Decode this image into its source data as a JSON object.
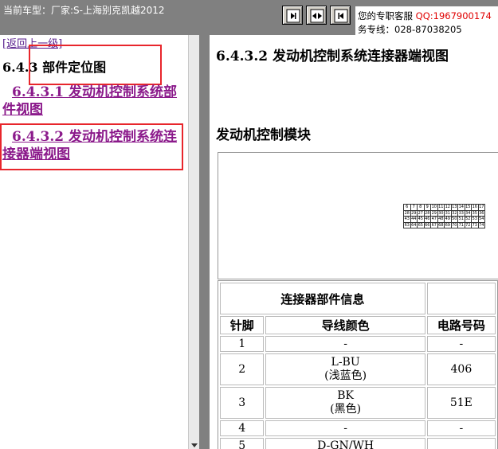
{
  "header": {
    "vehicle_text": "当前车型：厂家:S-上海别克凯越2012",
    "service_prefix": "您的专职客服",
    "qq_text": "QQ:1967900174",
    "hotline": "务专线：028-87038205"
  },
  "nav_buttons": [
    {
      "name": "first-page-icon"
    },
    {
      "name": "toggle-panes-icon"
    },
    {
      "name": "previous-page-icon"
    }
  ],
  "left_panel": {
    "back_link": "[返回上一级]",
    "section_title": "6.4.3 部件定位图",
    "toc": [
      {
        "label": "6.4.3.1 发动机控制系统部件视图"
      },
      {
        "label": "6.4.3.2 发动机控制系统连接器端视图"
      }
    ]
  },
  "content": {
    "title": "6.4.3.2 发动机控制系统连接器端视图",
    "subsection": "发动机控制模块",
    "connector_info_header": "连接器部件信息",
    "columns": [
      "针脚",
      "导线颜色",
      "电路号码"
    ],
    "rows": [
      {
        "pin": "1",
        "color": "-",
        "circuit": "-"
      },
      {
        "pin": "2",
        "color": "L-BU\n(浅蓝色)",
        "circuit": "406"
      },
      {
        "pin": "3",
        "color": "BK\n(黑色)",
        "circuit": "51E"
      },
      {
        "pin": "4",
        "color": "-",
        "circuit": "-"
      },
      {
        "pin": "5",
        "color": "D-GN/WH",
        "circuit": ""
      }
    ],
    "connector_grid": [
      [
        "6",
        "7",
        "8",
        "9",
        "10",
        "11",
        "12",
        "13",
        "14",
        "15",
        "16",
        "17"
      ],
      [
        "28",
        "29",
        "27",
        "28",
        "29",
        "30",
        "31",
        "32",
        "33",
        "34",
        "35",
        "36"
      ],
      [
        "43",
        "44",
        "45",
        "46",
        "47",
        "48",
        "49",
        "50",
        "51",
        "52",
        "53",
        "54"
      ],
      [
        "63",
        "64",
        "65",
        "66",
        "67",
        "68",
        "69",
        "70",
        "71",
        "72",
        "73",
        "74"
      ]
    ]
  },
  "colors": {
    "header_bg": "#808080",
    "link": "#8b1a8b",
    "highlight": "#e8262c",
    "qq": "#e00000"
  }
}
